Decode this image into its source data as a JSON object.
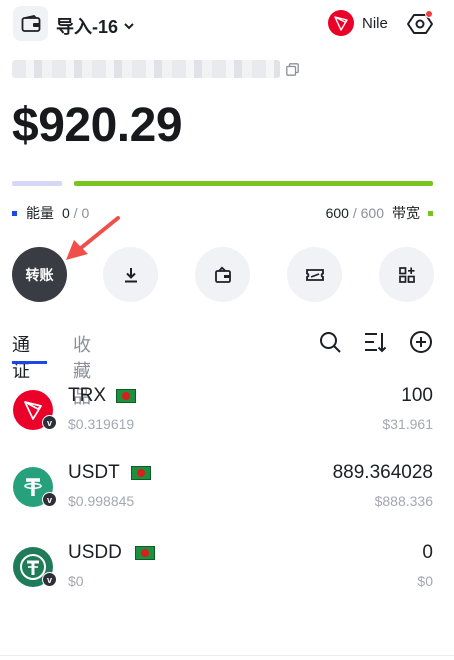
{
  "header": {
    "wallet_name": "导入-16",
    "network": "Nile"
  },
  "address": {
    "value": ""
  },
  "balance": "$920.29",
  "resources": {
    "energy_label": "能量",
    "energy_used": "0",
    "energy_sep": " / ",
    "energy_total": "0",
    "bandwidth_used": "600",
    "bandwidth_sep": " / ",
    "bandwidth_total": "600",
    "bandwidth_label": "带宽",
    "energy_color": "#1a47e5",
    "bandwidth_color": "#79c51f"
  },
  "actions": {
    "transfer_label": "转账",
    "icons": [
      "download-icon",
      "wallet-bag-icon",
      "ticket-icon",
      "grid-plus-icon"
    ]
  },
  "tabs": {
    "tokens": "通证",
    "collectibles": "收藏品"
  },
  "assets": [
    {
      "symbol": "TRX",
      "price": "$0.319619",
      "amount": "100",
      "value": "$31.961",
      "color": "#eb0029"
    },
    {
      "symbol": "USDT",
      "price": "$0.998845",
      "amount": "889.364028",
      "value": "$888.336",
      "color": "#26a17b"
    },
    {
      "symbol": "USDD",
      "price": "$0",
      "amount": "0",
      "value": "$0",
      "color": "#1f7b5a"
    }
  ],
  "colors": {
    "primary_action": "#393c43",
    "tab_accent": "#1a47e5",
    "annotation_arrow": "#f0504a"
  }
}
